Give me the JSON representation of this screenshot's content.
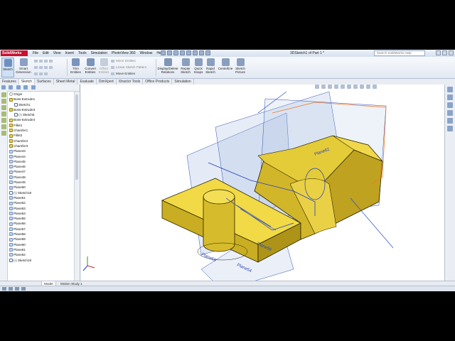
{
  "app": {
    "logo": "SolidWorks",
    "document_title": "3DSketch1 of Part 1 *",
    "search_placeholder": "Search SolidWorks Help"
  },
  "menu": [
    "File",
    "Edit",
    "View",
    "Insert",
    "Tools",
    "Simulation",
    "PhotoView 360",
    "Window",
    "Help"
  ],
  "command_manager": {
    "sketch": "Sketch",
    "smart_dimension": "Smart Dimension",
    "trim_entities": "Trim Entities",
    "convert_entities": "Convert Entities",
    "offset_entities": "Offset Entities",
    "mirror_entities": "Mirror Entities",
    "linear_sketch_pattern": "Linear Sketch Pattern",
    "move_entities": "Move Entities",
    "display_delete_relations": "Display/Delete Relations",
    "repair_sketch": "Repair Sketch",
    "quick_snaps": "Quick Snaps",
    "rapid_sketch": "Rapid Sketch",
    "centerline": "Centerline",
    "sketch_picture": "Sketch Picture"
  },
  "tabs": [
    "Features",
    "Sketch",
    "Surfaces",
    "Sheet Metal",
    "Evaluate",
    "DimXpert",
    "Xtractor Tools",
    "Office Products",
    "Simulation"
  ],
  "active_tab": "Sketch",
  "feature_tree": [
    {
      "label": "Origin",
      "icon": "origin",
      "indent": 0
    },
    {
      "label": "Boss-Extrude1",
      "icon": "feat",
      "indent": 0
    },
    {
      "label": "Sketch1",
      "icon": "sketch",
      "indent": 1
    },
    {
      "label": "Boss-Extrude3",
      "icon": "feat",
      "indent": 0
    },
    {
      "label": "(-) Sketch5",
      "icon": "sketch",
      "indent": 1
    },
    {
      "label": "Boss-Extrude4",
      "icon": "feat",
      "indent": 0
    },
    {
      "label": "Fillet1",
      "icon": "feat",
      "indent": 0
    },
    {
      "label": "Chamfer1",
      "icon": "feat",
      "indent": 0
    },
    {
      "label": "Fillet2",
      "icon": "feat",
      "indent": 0
    },
    {
      "label": "Chamfer2",
      "icon": "feat",
      "indent": 0
    },
    {
      "label": "Chamfer3",
      "icon": "feat",
      "indent": 0
    },
    {
      "label": "Plane43",
      "icon": "plane",
      "indent": 0
    },
    {
      "label": "Plane44",
      "icon": "plane",
      "indent": 0
    },
    {
      "label": "Plane45",
      "icon": "plane",
      "indent": 0
    },
    {
      "label": "Plane46",
      "icon": "plane",
      "indent": 0
    },
    {
      "label": "Plane47",
      "icon": "plane",
      "indent": 0
    },
    {
      "label": "Plane48",
      "icon": "plane",
      "indent": 0
    },
    {
      "label": "Plane49",
      "icon": "plane",
      "indent": 0
    },
    {
      "label": "Plane50",
      "icon": "plane",
      "indent": 0
    },
    {
      "label": "(-) Sketch18",
      "icon": "sketch",
      "indent": 0
    },
    {
      "label": "Plane51",
      "icon": "plane",
      "indent": 0
    },
    {
      "label": "Plane52",
      "icon": "plane",
      "indent": 0
    },
    {
      "label": "Plane53",
      "icon": "plane",
      "indent": 0
    },
    {
      "label": "Plane54",
      "icon": "plane",
      "indent": 0
    },
    {
      "label": "Plane55",
      "icon": "plane",
      "indent": 0
    },
    {
      "label": "Plane56",
      "icon": "plane",
      "indent": 0
    },
    {
      "label": "Plane57",
      "icon": "plane",
      "indent": 0
    },
    {
      "label": "Plane58",
      "icon": "plane",
      "indent": 0
    },
    {
      "label": "Plane59",
      "icon": "plane",
      "indent": 0
    },
    {
      "label": "Plane60",
      "icon": "plane",
      "indent": 0
    },
    {
      "label": "Plane61",
      "icon": "plane",
      "indent": 0
    },
    {
      "label": "Plane62",
      "icon": "plane",
      "indent": 0
    },
    {
      "label": "(-) Sketch19",
      "icon": "sketch",
      "indent": 0
    }
  ],
  "viewport": {
    "plane_labels": [
      "Plane62",
      "Plane59",
      "Plane54",
      "Plane56"
    ]
  },
  "bottom_tabs": [
    "Model",
    "Motion Study 1"
  ],
  "active_bottom_tab": "Model",
  "colors": {
    "part_face": "#e6cc38",
    "part_edge": "#2b2400",
    "plane_fill": "#9fb6e0",
    "sketch_blue": "#1f3fbf",
    "sketch_orange": "#ee7a2a"
  }
}
